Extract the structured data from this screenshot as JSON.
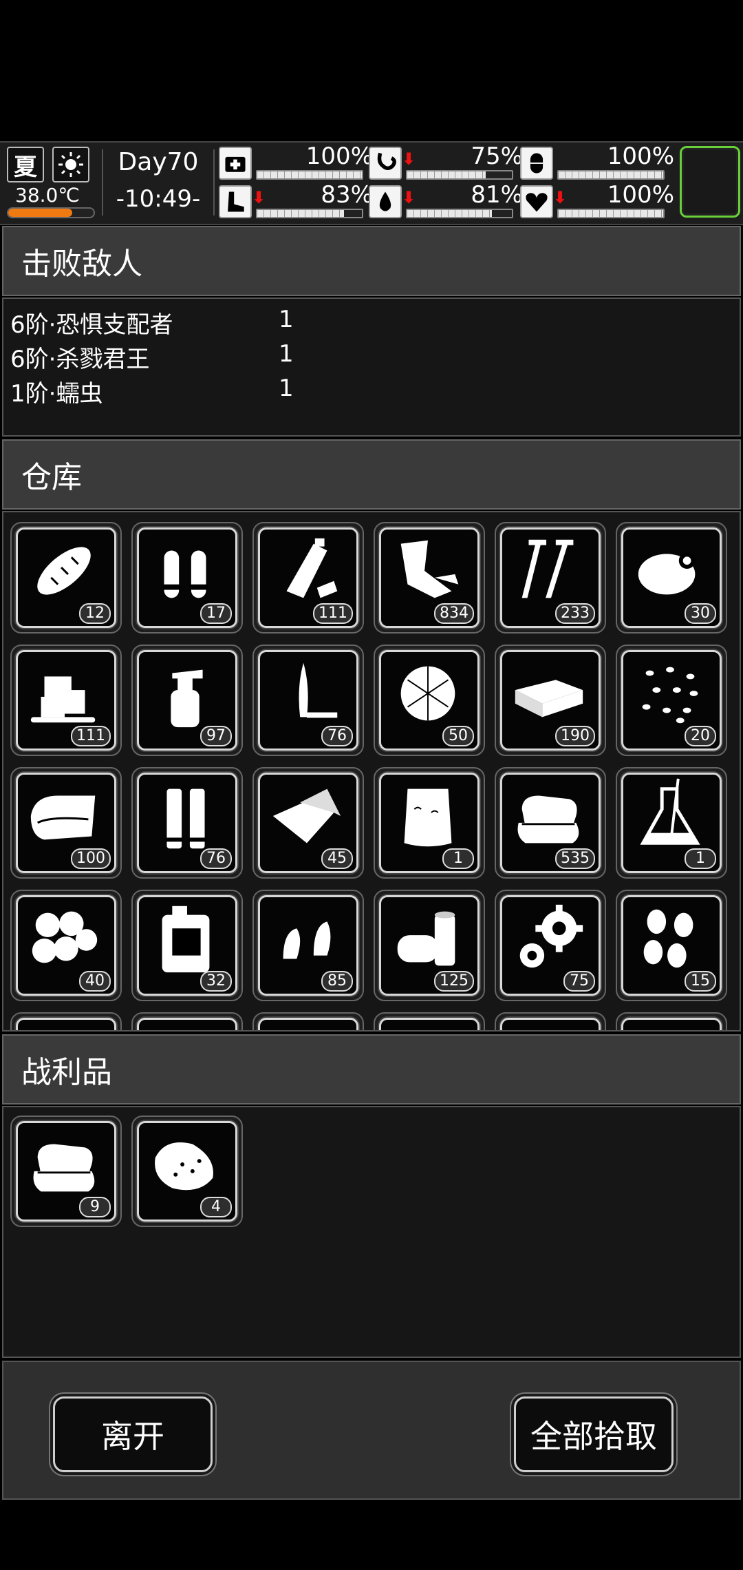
{
  "status": {
    "season": "夏",
    "weather_icon": "sun-icon",
    "temperature": "38.0℃",
    "temperature_level": 0.75,
    "day": "Day70",
    "time": "-10:49-",
    "stats": [
      {
        "icon": "medkit-icon",
        "pct": "100%",
        "level": 1.0,
        "down": false
      },
      {
        "icon": "stomach-icon",
        "pct": "75%",
        "level": 0.75,
        "down": true
      },
      {
        "icon": "pill-icon",
        "pct": "100%",
        "level": 1.0,
        "down": false
      },
      {
        "icon": "foot-icon",
        "pct": "83%",
        "level": 0.83,
        "down": true
      },
      {
        "icon": "water-drop-icon",
        "pct": "81%",
        "level": 0.81,
        "down": true
      },
      {
        "icon": "heart-icon",
        "pct": "100%",
        "level": 1.0,
        "down": true
      }
    ]
  },
  "defeated": {
    "title": "击败敌人",
    "enemies": [
      {
        "name": "6阶·恐惧支配者",
        "count": "1"
      },
      {
        "name": "6阶·杀戮君王",
        "count": "1"
      },
      {
        "name": "1阶·蠕虫",
        "count": "1"
      }
    ]
  },
  "storage": {
    "title": "仓库",
    "items": [
      {
        "icon": "bread-icon",
        "qty": "12"
      },
      {
        "icon": "bullets-icon",
        "qty": "17"
      },
      {
        "icon": "plastic-bottle-icon",
        "qty": "111"
      },
      {
        "icon": "rags-icon",
        "qty": "834"
      },
      {
        "icon": "screws-icon",
        "qty": "233"
      },
      {
        "icon": "meat-icon",
        "qty": "30"
      },
      {
        "icon": "ice-cubes-icon",
        "qty": "111"
      },
      {
        "icon": "spray-bottle-icon",
        "qty": "97"
      },
      {
        "icon": "knife-icon",
        "qty": "76"
      },
      {
        "icon": "cotton-icon",
        "qty": "50"
      },
      {
        "icon": "cash-bundle-icon",
        "qty": "190"
      },
      {
        "icon": "seeds-icon",
        "qty": "20"
      },
      {
        "icon": "cloth-icon",
        "qty": "100"
      },
      {
        "icon": "shotgun-shells-icon",
        "qty": "76"
      },
      {
        "icon": "fabric-sheets-icon",
        "qty": "45"
      },
      {
        "icon": "sack-icon",
        "qty": "1"
      },
      {
        "icon": "folded-clothes-icon",
        "qty": "535"
      },
      {
        "icon": "flask-icon",
        "qty": "1"
      },
      {
        "icon": "cotton-balls-icon",
        "qty": "40"
      },
      {
        "icon": "jerrycan-icon",
        "qty": "32"
      },
      {
        "icon": "earplugs-icon",
        "qty": "85"
      },
      {
        "icon": "cans-icon",
        "qty": "125"
      },
      {
        "icon": "gears-icon",
        "qty": "75"
      },
      {
        "icon": "nuts-icon",
        "qty": "15"
      }
    ]
  },
  "loot": {
    "title": "战利品",
    "items": [
      {
        "icon": "folded-clothes-icon",
        "qty": "9"
      },
      {
        "icon": "raw-meat-icon",
        "qty": "4"
      }
    ]
  },
  "buttons": {
    "leave": "离开",
    "take_all": "全部拾取"
  }
}
